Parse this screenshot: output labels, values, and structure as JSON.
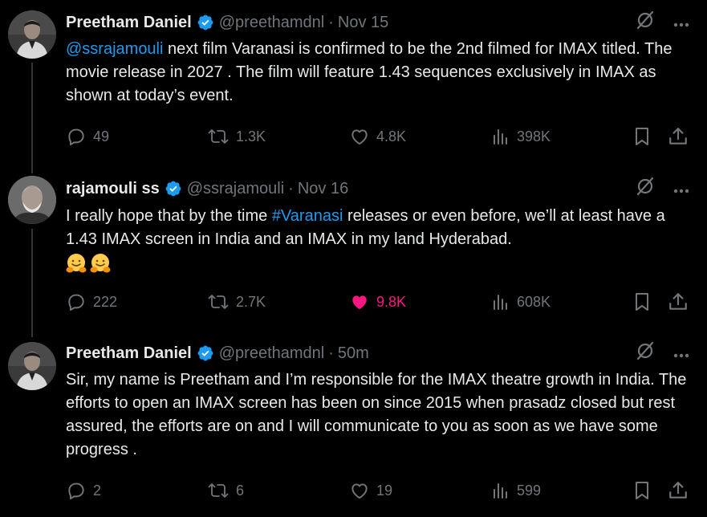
{
  "tweets": [
    {
      "name": "Preetham Daniel",
      "handle": "@preethamdnl",
      "sep": "·",
      "time": "Nov 15",
      "text_mention": "@ssrajamouli",
      "text_rest": " next film Varanasi is confirmed to be the 2nd filmed for IMAX titled. The movie release in 2027 . The film will feature 1.43 sequences exclusively in IMAX as shown at today’s event.",
      "replies": "49",
      "reposts": "1.3K",
      "likes": "4.8K",
      "views": "398K"
    },
    {
      "name": "rajamouli ss",
      "handle": "@ssrajamouli",
      "sep": "·",
      "time": "Nov 16",
      "text_before": "I really hope that by the time ",
      "text_hashtag": "#Varanasi",
      "text_after": " releases or even before, we’ll at least have a 1.43 IMAX screen in India and an IMAX in my land Hyderabad.",
      "replies": "222",
      "reposts": "2.7K",
      "likes": "9.8K",
      "views": "608K"
    },
    {
      "name": "Preetham Daniel",
      "handle": "@preethamdnl",
      "sep": "·",
      "time": "50m",
      "text": "Sir, my name is Preetham and I’m responsible for the IMAX theatre growth in India. The efforts to open an IMAX screen has been on since 2015 when prasadz closed but rest assured, the efforts are on and I will communicate to you as soon as we have some progress .",
      "replies": "2",
      "reposts": "6",
      "likes": "19",
      "views": "599"
    }
  ],
  "colors": {
    "background": "#000000",
    "text": "#e7e9ea",
    "muted": "#71767b",
    "link": "#1d9bf0",
    "verified": "#1d9bf0",
    "liked": "#f91880"
  },
  "icons": [
    "verified-badge-icon",
    "grok-icon",
    "more-icon",
    "reply-icon",
    "repost-icon",
    "like-icon",
    "views-icon",
    "bookmark-icon",
    "share-icon",
    "hugging-face-emoji"
  ]
}
